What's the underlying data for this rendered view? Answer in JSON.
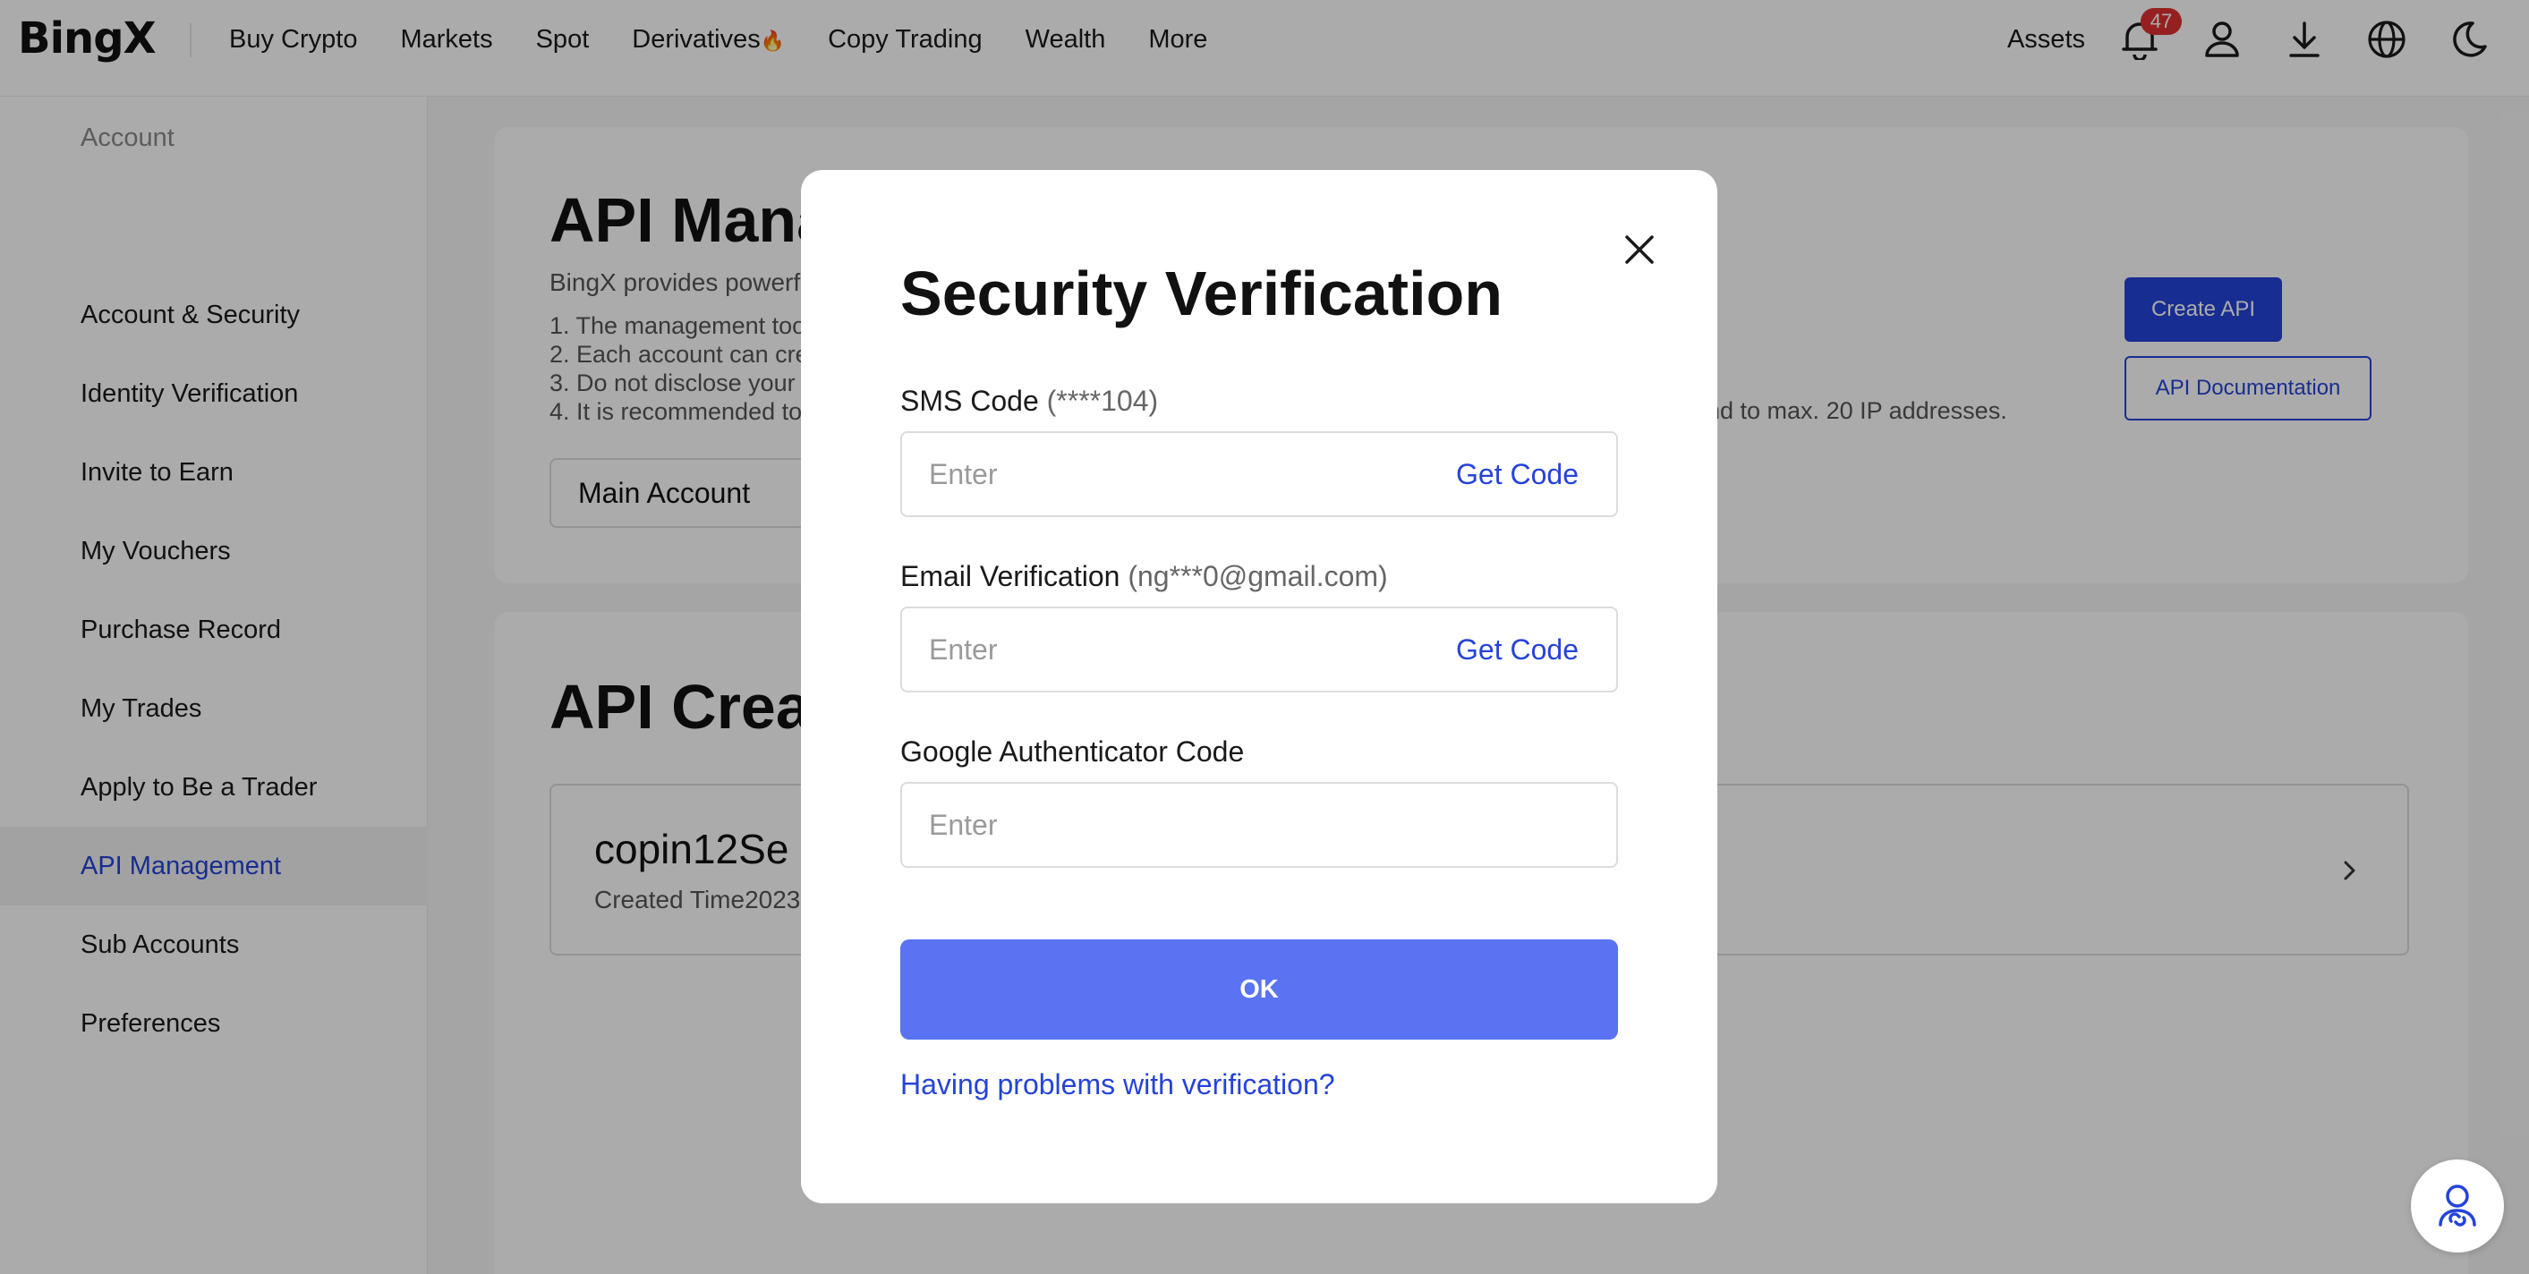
{
  "nav": {
    "logo_text": "BingX",
    "links": [
      "Buy Crypto",
      "Markets",
      "Spot",
      "Derivatives",
      "Copy Trading",
      "Wealth",
      "More"
    ],
    "derivatives_badge": "🔥",
    "assets": "Assets",
    "notification_count": "47",
    "icons": [
      "bell-icon",
      "user-icon",
      "download-icon",
      "globe-icon",
      "moon-icon"
    ]
  },
  "sidebar": {
    "heading": "Account",
    "items": [
      {
        "label": "Account & Security"
      },
      {
        "label": "Identity Verification"
      },
      {
        "label": "Invite to Earn"
      },
      {
        "label": "My Vouchers"
      },
      {
        "label": "Purchase Record"
      },
      {
        "label": "My Trades"
      },
      {
        "label": "Apply to Be a Trader"
      },
      {
        "label": "API Management",
        "active": true
      },
      {
        "label": "Sub Accounts"
      },
      {
        "label": "Preferences"
      }
    ]
  },
  "main": {
    "title": "API Management",
    "description": "BingX provides powerful APIs",
    "rules": [
      "1. The management tool",
      "2. Each account can create",
      "3. Do not disclose your",
      "4. It is recommended to"
    ],
    "rule_4_tail": "nd to max. 20 IP addresses.",
    "create_button": "Create API",
    "docs_button": "API Documentation",
    "account_select": "Main Account",
    "created_title": "API Created",
    "api_row": {
      "name": "copin12Se",
      "created_time": "Created Time2023"
    }
  },
  "modal": {
    "title": "Security Verification",
    "sms_label": "SMS Code",
    "sms_hint": "(****104)",
    "email_label": "Email Verification",
    "email_hint": "(ng***0@gmail.com)",
    "google_label": "Google Authenticator Code",
    "placeholder": "Enter",
    "get_code": "Get Code",
    "ok_button": "OK",
    "help_link": "Having problems with verification?"
  },
  "colors": {
    "accent": "#2543d9",
    "ok_button": "#5a73f2",
    "badge": "#e03131"
  }
}
